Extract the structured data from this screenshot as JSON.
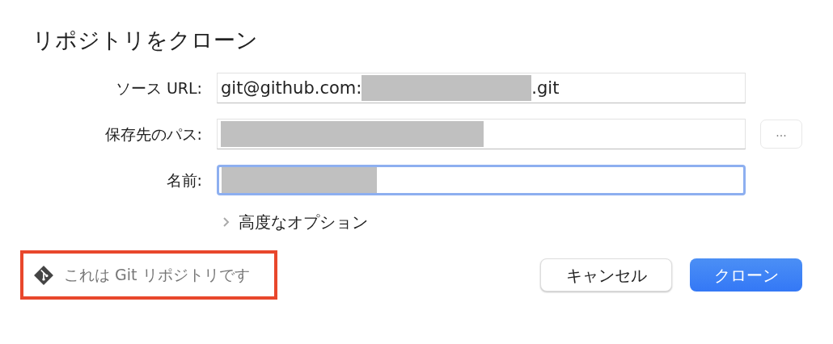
{
  "dialog": {
    "title": "リポジトリをクローン"
  },
  "fields": [
    {
      "label": "ソース URL:",
      "text_before": "git@github.com:",
      "redacted": true,
      "text_after": ".git",
      "focused": false
    },
    {
      "label": "保存先のパス:",
      "redacted": true,
      "focused": false,
      "browse_button": "..."
    },
    {
      "label": "名前:",
      "redacted": true,
      "focused": true
    }
  ],
  "advanced_options": {
    "label": "高度なオプション",
    "expanded": false
  },
  "repo_status": {
    "text": "これは Git リポジトリです",
    "highlighted": true
  },
  "buttons": [
    {
      "label": "キャンセル",
      "kind": "secondary"
    },
    {
      "label": "クローン",
      "kind": "primary"
    }
  ]
}
